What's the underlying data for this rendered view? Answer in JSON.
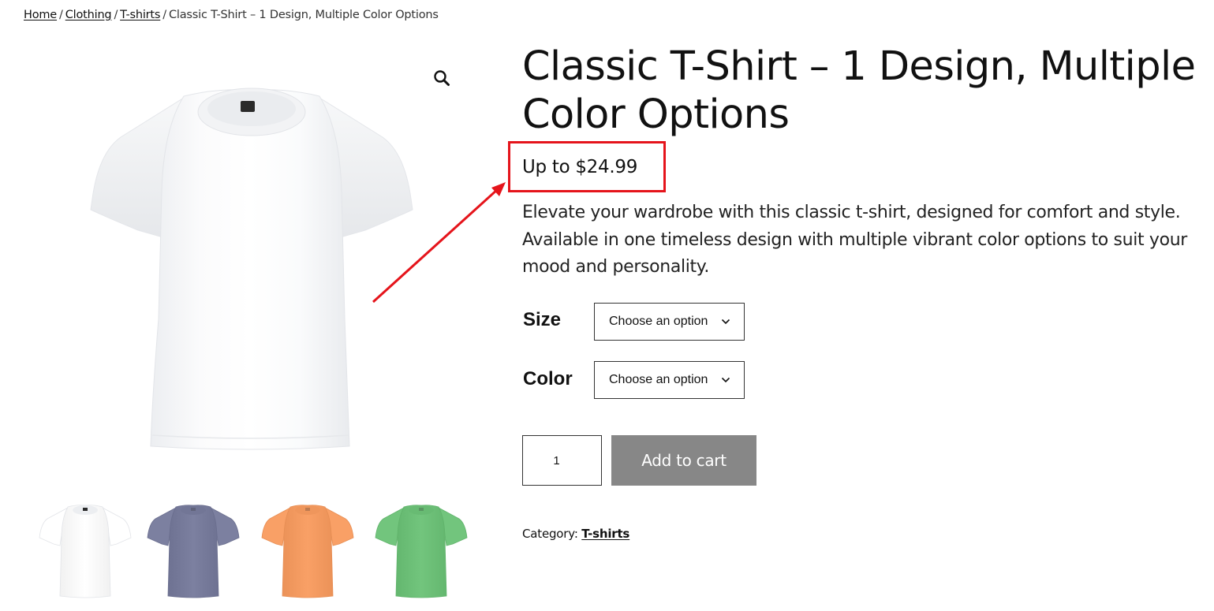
{
  "breadcrumb": {
    "home": "Home",
    "clothing": "Clothing",
    "tshirts": "T-shirts",
    "current": "Classic T-Shirt – 1 Design, Multiple Color Options",
    "separator": "/"
  },
  "gallery": {
    "zoom_icon": "magnifier-icon",
    "main_image_color": "#ffffff",
    "thumbnails": [
      {
        "color": "#ffffff",
        "icon": "tshirt-white-icon"
      },
      {
        "color": "#7c80a0",
        "icon": "tshirt-slate-icon"
      },
      {
        "color": "#f9a066",
        "icon": "tshirt-orange-icon"
      },
      {
        "color": "#72c57d",
        "icon": "tshirt-green-icon"
      }
    ]
  },
  "product": {
    "title": "Classic T-Shirt – 1 Design, Multiple Color Options",
    "price": "Up to $24.99",
    "description": "Elevate your wardrobe with this classic t-shirt, designed for comfort and style. Available in one timeless design with multiple vibrant color options to suit your mood and personality."
  },
  "variations": {
    "size": {
      "label": "Size",
      "selected": "Choose an option"
    },
    "color": {
      "label": "Color",
      "selected": "Choose an option"
    }
  },
  "cart": {
    "quantity": "1",
    "add_label": "Add to cart",
    "button_color": "#878787"
  },
  "meta": {
    "category_label": "Category:",
    "category_value": "T-shirts"
  },
  "annotation": {
    "color": "#e5141b"
  }
}
